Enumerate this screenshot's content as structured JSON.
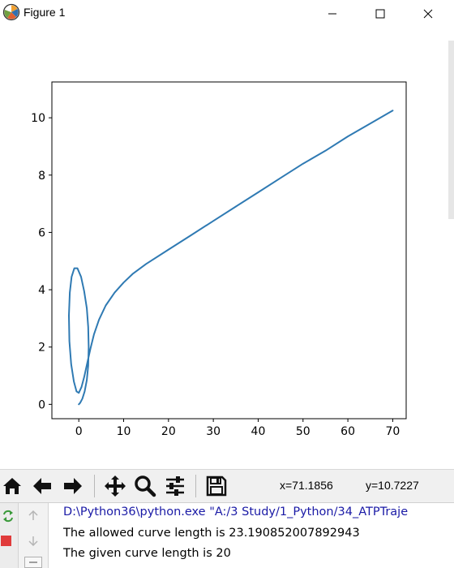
{
  "window": {
    "title": "Figure 1",
    "minimize_icon": "minimize-icon",
    "maximize_icon": "maximize-icon",
    "close_icon": "close-icon"
  },
  "chart_data": {
    "type": "line",
    "title": "",
    "xlabel": "",
    "ylabel": "",
    "xlim": [
      -6,
      73
    ],
    "ylim": [
      -0.5,
      11.25
    ],
    "xticks": [
      0,
      10,
      20,
      30,
      40,
      50,
      60,
      70
    ],
    "yticks": [
      0,
      2,
      4,
      6,
      8,
      10
    ],
    "grid": false,
    "color": "#2f7ab3",
    "series": [
      {
        "x": [
          0,
          0.3,
          0.8,
          1.3,
          1.8,
          2.1,
          2.2,
          2.1,
          1.8,
          1.2,
          0.5,
          -0.3,
          -1.0,
          -1.6,
          -2.0,
          -2.2,
          -2.1,
          -1.7,
          -1.1,
          -0.5,
          0.0,
          0.6,
          1.2,
          1.9,
          2.6,
          3.4,
          4.5,
          6,
          8,
          10,
          12,
          15,
          20,
          25,
          30,
          35,
          40,
          45,
          50,
          55,
          60,
          65,
          70
        ],
        "y": [
          0,
          0.05,
          0.2,
          0.45,
          0.85,
          1.35,
          2.0,
          2.7,
          3.35,
          3.95,
          4.45,
          4.75,
          4.75,
          4.45,
          3.9,
          3.1,
          2.2,
          1.4,
          0.8,
          0.45,
          0.4,
          0.6,
          0.95,
          1.45,
          1.95,
          2.45,
          2.95,
          3.45,
          3.9,
          4.25,
          4.55,
          4.9,
          5.4,
          5.9,
          6.4,
          6.9,
          7.4,
          7.9,
          8.4,
          8.85,
          9.35,
          9.8,
          10.25
        ]
      }
    ]
  },
  "toolbar": {
    "buttons": [
      {
        "name": "home-icon"
      },
      {
        "name": "back-arrow-icon"
      },
      {
        "name": "forward-arrow-icon"
      },
      {
        "name": "pan-icon"
      },
      {
        "name": "zoom-icon"
      },
      {
        "name": "configure-subplots-icon"
      },
      {
        "name": "save-icon"
      }
    ],
    "x_readout": "x=71.1856",
    "y_readout": "y=10.7227"
  },
  "console": {
    "lines": [
      {
        "text": "D:\\Python36\\python.exe \"A:/3 Study/1_Python/34_ATPTraje",
        "color": "#1a1aa6"
      },
      {
        "text": "The allowed curve length is 23.190852007892943",
        "color": "#000000"
      },
      {
        "text": "The given curve length is 20",
        "color": "#000000"
      }
    ],
    "gutter_icons": [
      "rerun-icon",
      "stop-icon",
      "up-arrow-icon",
      "down-arrow-icon",
      "collapse-icon"
    ]
  }
}
